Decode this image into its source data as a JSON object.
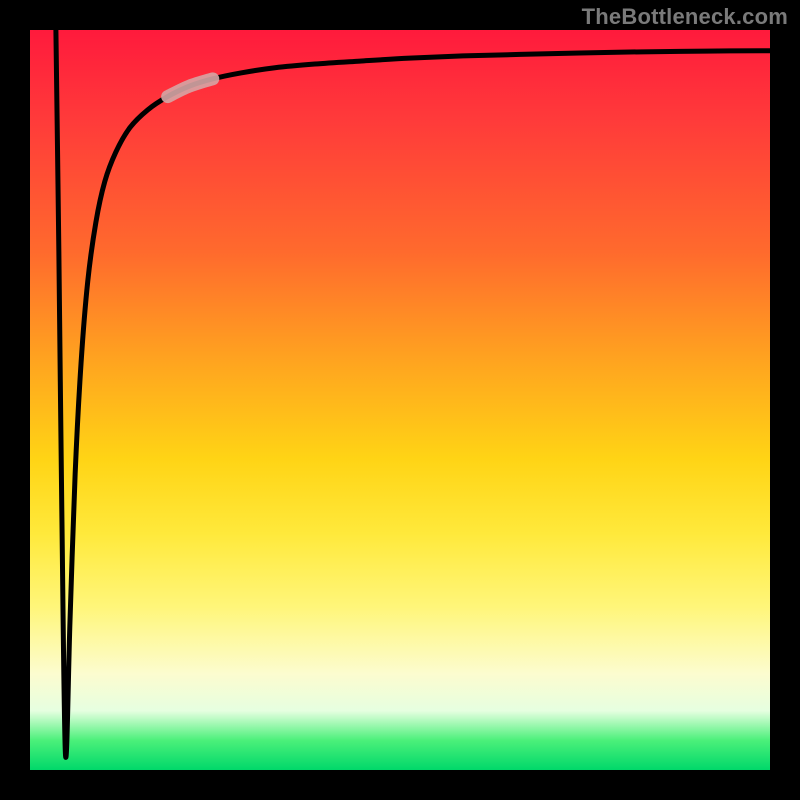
{
  "watermark": "TheBottleneck.com",
  "colors": {
    "frame": "#000000",
    "curve": "#000000",
    "highlight": "#d6a5a5",
    "gradient_stops": [
      "#ff1a3c",
      "#ff3a3a",
      "#ff6a2d",
      "#ffa51f",
      "#ffd415",
      "#ffe93b",
      "#fff67a",
      "#fcfccf",
      "#e6ffe0",
      "#4bf07a",
      "#00d86a"
    ]
  },
  "chart_data": {
    "type": "line",
    "title": "",
    "xlabel": "",
    "ylabel": "",
    "xlim": [
      0,
      100
    ],
    "ylim": [
      0,
      100
    ],
    "grid": false,
    "note": "Axes are unlabeled. Values below are estimated from pixel positions; Y interpreted as higher = top of image = 100.",
    "series": [
      {
        "name": "curve",
        "x": [
          3.5,
          3.9,
          4.3,
          4.8,
          5.4,
          6.1,
          6.9,
          7.8,
          8.9,
          10.1,
          11.6,
          13.5,
          15.9,
          18.6,
          21.5,
          24.7,
          28.5,
          33.1,
          38.5,
          44.6,
          51.3,
          58.5,
          66.2,
          74.3,
          82.7,
          91.4,
          100.0
        ],
        "y": [
          100,
          70,
          35,
          2,
          20,
          40,
          55,
          66,
          74,
          79.5,
          83.5,
          86.8,
          89.2,
          91,
          92.4,
          93.4,
          94.2,
          94.9,
          95.4,
          95.8,
          96.2,
          96.5,
          96.7,
          96.9,
          97.05,
          97.15,
          97.2
        ]
      }
    ],
    "highlight_segment": {
      "x_from": 18.6,
      "x_to": 24.7
    }
  }
}
